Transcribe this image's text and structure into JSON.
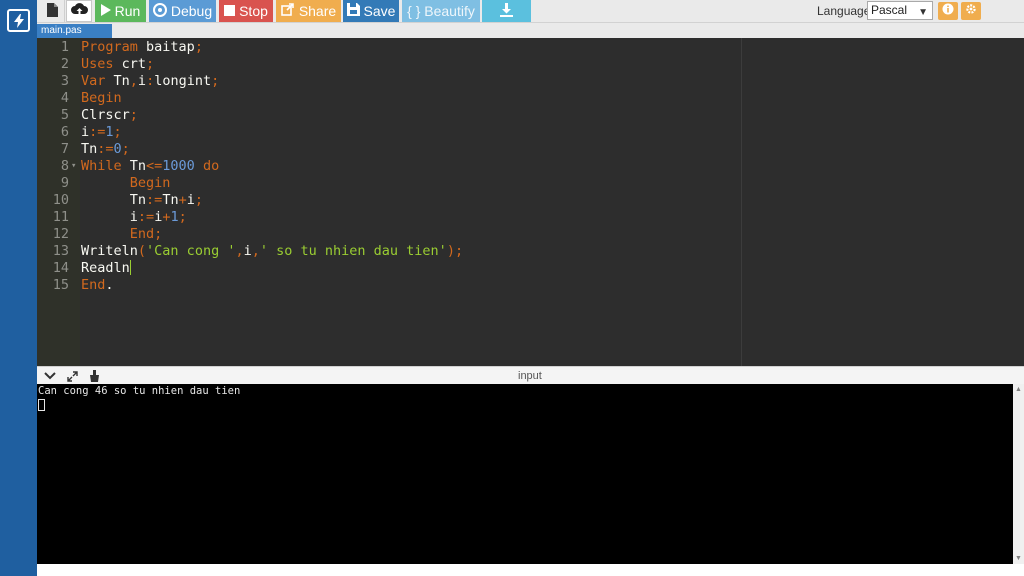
{
  "toolbar": {
    "run_label": "Run",
    "debug_label": "Debug",
    "stop_label": "Stop",
    "share_label": "Share",
    "save_label": "Save",
    "beautify_label": "{ } Beautify",
    "language_label": "Language",
    "language_selected": "Pascal"
  },
  "file_tab": {
    "name": "main.pas"
  },
  "editor": {
    "lines": [
      {
        "n": "1"
      },
      {
        "n": "2"
      },
      {
        "n": "3"
      },
      {
        "n": "4"
      },
      {
        "n": "5"
      },
      {
        "n": "6"
      },
      {
        "n": "7"
      },
      {
        "n": "8"
      },
      {
        "n": "9"
      },
      {
        "n": "10"
      },
      {
        "n": "11"
      },
      {
        "n": "12"
      },
      {
        "n": "13"
      },
      {
        "n": "14"
      },
      {
        "n": "15"
      }
    ],
    "tokens": {
      "l1": [
        "Program",
        " baitap",
        ";"
      ],
      "l2": [
        "Uses",
        " crt",
        ";"
      ],
      "l3": [
        "Var",
        " Tn",
        ",",
        "i",
        ":",
        "longint",
        ";"
      ],
      "l4": [
        "Begin"
      ],
      "l5": [
        "Clrscr",
        ";"
      ],
      "l6": [
        "i",
        ":=",
        "1",
        ";"
      ],
      "l7": [
        "Tn",
        ":=",
        "0",
        ";"
      ],
      "l8": [
        "While",
        " Tn",
        "<=",
        "1000",
        " do"
      ],
      "l9": [
        "      ",
        "Begin"
      ],
      "l10": [
        "      ",
        "Tn",
        ":=",
        "Tn",
        "+",
        "i",
        ";"
      ],
      "l11": [
        "      ",
        "i",
        ":=",
        "i",
        "+",
        "1",
        ";"
      ],
      "l12": [
        "      ",
        "End",
        ";"
      ],
      "l13": [
        "Writeln",
        "(",
        "'Can cong '",
        ",",
        "i",
        ",",
        "' so tu nhien dau tien'",
        ")",
        ";"
      ],
      "l14": [
        "Readln"
      ],
      "l15": [
        "End",
        "."
      ]
    }
  },
  "output": {
    "title": "input",
    "console_line": "Can cong 46 so tu nhien dau tien"
  },
  "colors": {
    "sidebar": "#1f5fa0",
    "editor_bg": "#2d2d2d",
    "keyword": "#d2691e",
    "number": "#6b9ad8",
    "string": "#9acd32"
  }
}
